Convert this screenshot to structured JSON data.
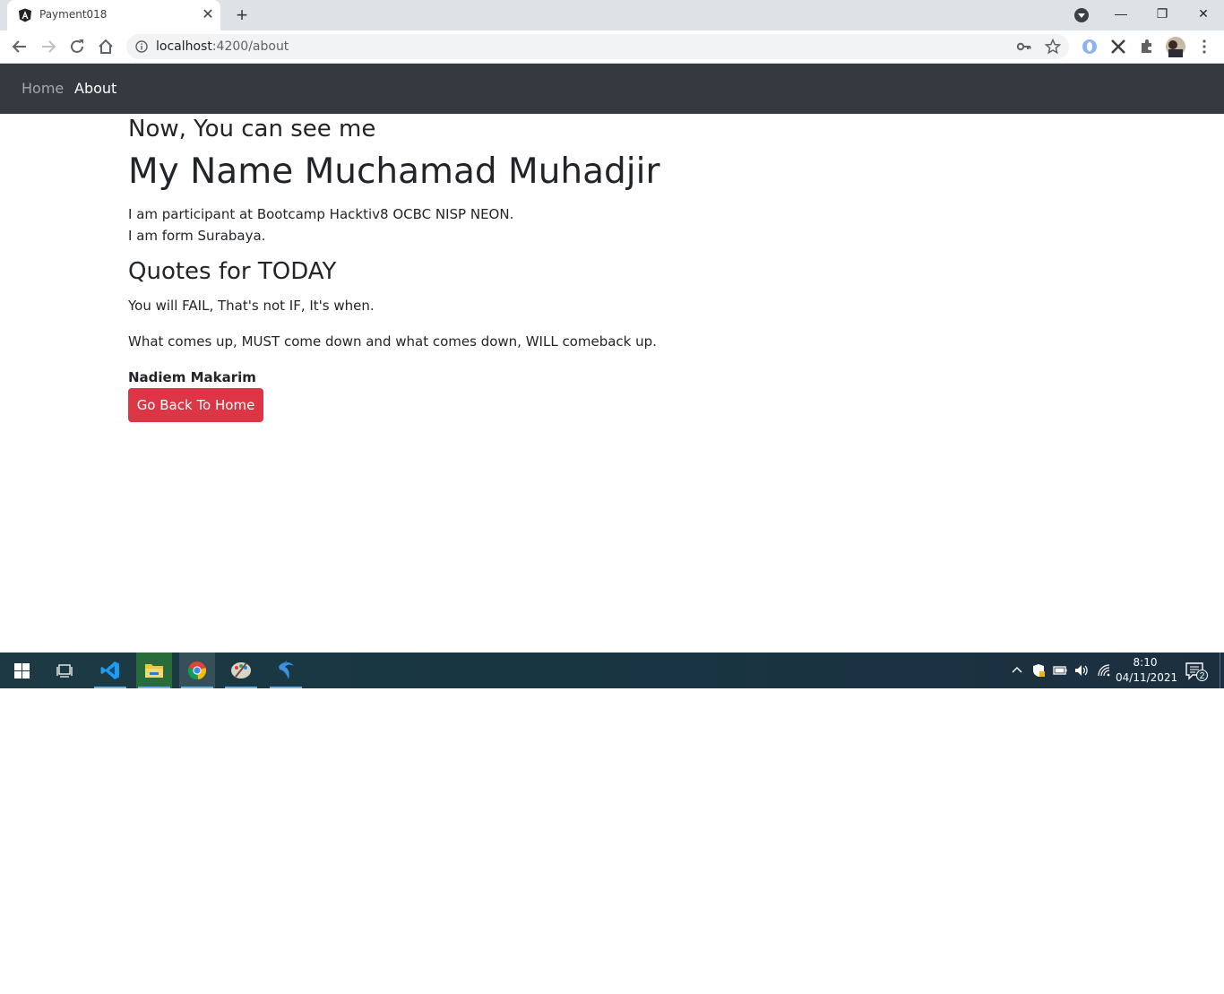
{
  "browser": {
    "tab_title": "Payment018",
    "url_host": "localhost",
    "url_rest": ":4200/about",
    "window_controls": {
      "minimize": "—",
      "restore": "❐",
      "close": "✕"
    }
  },
  "navbar": {
    "items": [
      {
        "label": "Home",
        "active": false
      },
      {
        "label": "About",
        "active": true
      }
    ]
  },
  "page": {
    "subtitle": "Now, You can see me",
    "title": "My Name Muchamad Muhadjir",
    "intro_line1": "I am participant at Bootcamp Hacktiv8 OCBC NISP NEON.",
    "intro_line2": "I am form Surabaya.",
    "quotes_heading": "Quotes for TODAY",
    "quote1": "You will FAIL, That's not IF, It's when.",
    "quote2": "What comes up, MUST come down and what comes down, WILL comeback up.",
    "quote_author": "Nadiem Makarim",
    "back_button": "Go Back To Home"
  },
  "taskbar": {
    "apps": [
      "windows-start-icon",
      "task-view-icon",
      "vscode-icon",
      "file-explorer-icon",
      "chrome-icon",
      "paint-icon",
      "dolphin-icon"
    ],
    "time": "8:10",
    "date": "04/11/2021",
    "notification_count": "2"
  },
  "colors": {
    "navbar": "#343a40",
    "button_danger": "#dc3545",
    "text": "#212529"
  }
}
